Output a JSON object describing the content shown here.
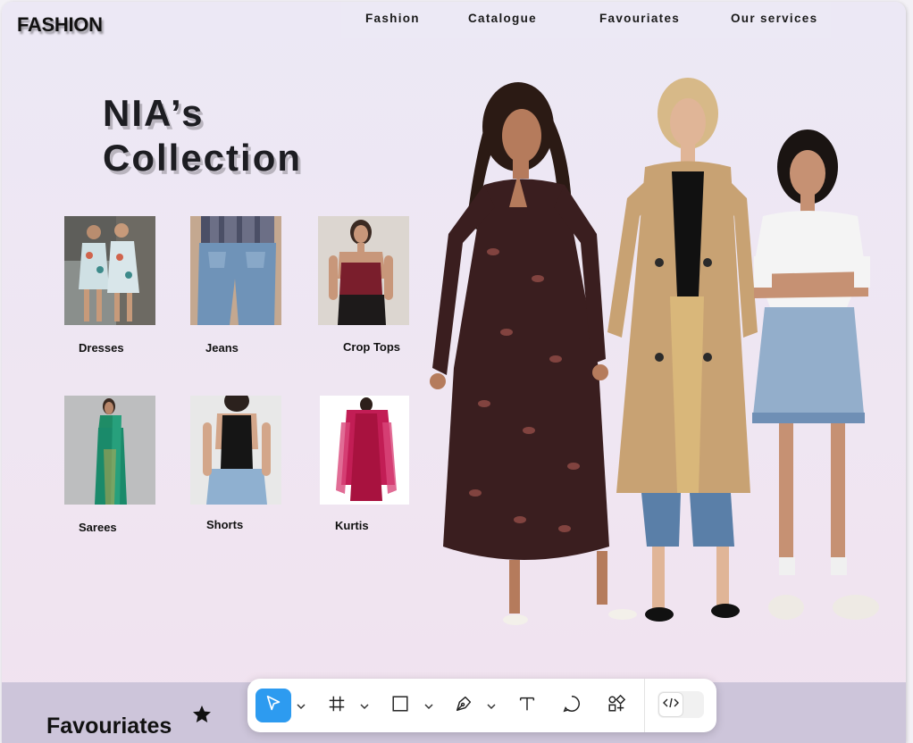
{
  "header": {
    "logo": "FASHION",
    "nav": [
      "Fashion",
      "Catalogue",
      "Favouriates",
      "Our services"
    ]
  },
  "hero": {
    "title_line1": "NIA’s",
    "title_line2": "Collection"
  },
  "categories": [
    {
      "label": "Dresses"
    },
    {
      "label": "Jeans"
    },
    {
      "label": "Crop Tops"
    },
    {
      "label": "Sarees"
    },
    {
      "label": "Shorts"
    },
    {
      "label": "Kurtis"
    }
  ],
  "favourites": {
    "heading": "Favouriates"
  },
  "toolbar": {
    "tools": [
      "move-tool",
      "frame-tool",
      "rectangle-tool",
      "pen-tool",
      "text-tool",
      "comment-tool",
      "components-tool",
      "dev-mode-toggle"
    ],
    "active_tool": "move-tool",
    "accent": "#2d9bf0"
  },
  "colors": {
    "page_bg_top": "#ece8f5",
    "page_bg_bottom": "#f1e2ef",
    "bottom_band": "#cdc5da"
  }
}
